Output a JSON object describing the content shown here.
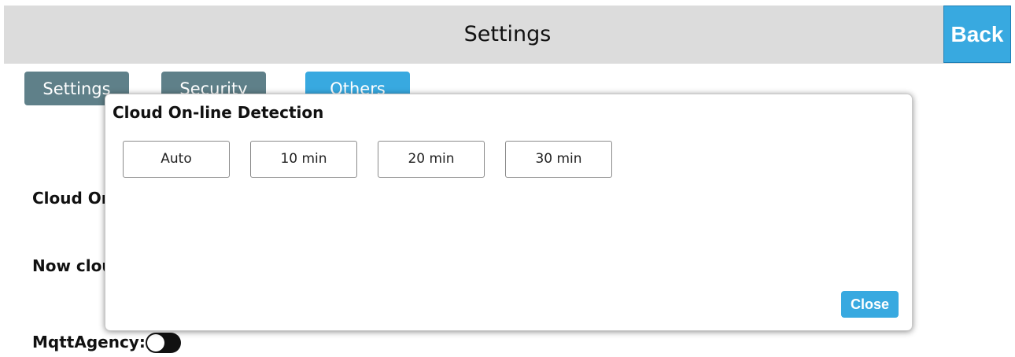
{
  "header": {
    "title": "Settings",
    "back_label": "Back"
  },
  "tabs": [
    {
      "label": "Settings",
      "active": false
    },
    {
      "label": "Security",
      "active": false
    },
    {
      "label": "Others",
      "active": true
    }
  ],
  "background": {
    "cloud_online_label": "Cloud On",
    "now_cloud_label": "Now clou",
    "mqtt_label": "MqttAgency:",
    "mqtt_enabled": false
  },
  "modal": {
    "title": "Cloud On-line Detection",
    "options": [
      "Auto",
      "10 min",
      "20 min",
      "30 min"
    ],
    "close_label": "Close"
  },
  "colors": {
    "accent": "#38a9e0",
    "tab_inactive": "#5f8089",
    "header_bg": "#dcdcdc"
  }
}
